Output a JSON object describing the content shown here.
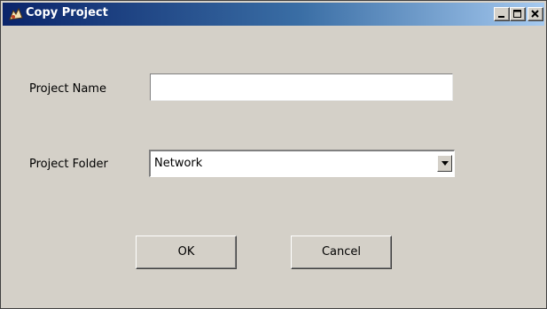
{
  "window": {
    "title": "Copy Project",
    "controls": {
      "minimize_icon": "minimize-icon",
      "maximize_icon": "maximize-icon",
      "close_icon": "close-icon"
    }
  },
  "form": {
    "project_name_label": "Project Name",
    "project_name_value": "",
    "project_folder_label": "Project Folder",
    "project_folder_selected": "Network"
  },
  "buttons": {
    "ok_label": "OK",
    "cancel_label": "Cancel"
  },
  "colors": {
    "titlebar_start": "#0a246a",
    "titlebar_end": "#a6caf0",
    "window_bg": "#d4d0c8"
  }
}
